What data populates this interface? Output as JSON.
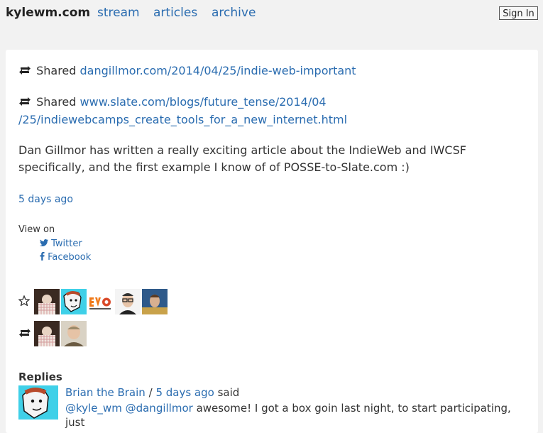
{
  "site": {
    "brand": "kylewm.com",
    "nav": [
      {
        "label": "stream"
      },
      {
        "label": "articles"
      },
      {
        "label": "archive"
      }
    ],
    "signin_label": "Sign In"
  },
  "post": {
    "shares": [
      {
        "prefix": "Shared",
        "url_line1": "dangillmor.com/2014/04/25/indie-web-important",
        "url_line2": ""
      },
      {
        "prefix": "Shared",
        "url_line1": "www.slate.com/blogs/future_tense/2014/04",
        "url_line2": "/25/indiewebcamps_create_tools_for_a_new_internet.html"
      }
    ],
    "body_line1": "Dan Gillmor has written a really exciting article about the IndieWeb and IWCSF",
    "body_line2": "specifically, and the first example I know of of POSSE-to-Slate.com :)",
    "published": "5 days ago"
  },
  "syndication": {
    "label": "View on",
    "links": [
      {
        "label": "Twitter",
        "icon": "twitter-icon"
      },
      {
        "label": "Facebook",
        "icon": "facebook-icon"
      }
    ]
  },
  "reactions": {
    "favorites_icon": "star-icon",
    "reposts_icon": "repost-icon"
  },
  "replies": {
    "title": "Replies",
    "items": [
      {
        "author": "Brian the Brain",
        "separator": "/",
        "time": "5 days ago",
        "said": "said",
        "mention1": "@kyle_wm",
        "mention2": "@dangillmor",
        "text": "awesome! I got a box goin last night, to start participating, just"
      }
    ]
  },
  "colors": {
    "link": "#2a6cb0",
    "background": "#f2f2f2",
    "card": "#ffffff"
  }
}
